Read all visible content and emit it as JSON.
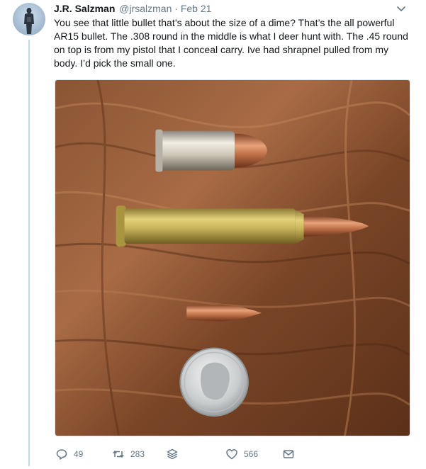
{
  "tweet": {
    "author_name": "J.R. Salzman",
    "handle": "@jrsalzman",
    "separator": "·",
    "date": "Feb 21",
    "text": "You see that little bullet that’s about the size of a dime? That’s the all powerful AR15 bullet. The .308 round in the middle is what I deer hunt with. The .45 round on top is from my pistol that I conceal carry. Ive had shrapnel pulled from my body. I’d pick the small one."
  },
  "actions": {
    "reply_count": "49",
    "retweet_count": "283",
    "like_count": "566"
  },
  "icons": {
    "avatar": "profile-photo",
    "more": "chevron-down-icon",
    "reply": "reply-icon",
    "retweet": "retweet-icon",
    "stack": "layers-icon",
    "like": "heart-icon",
    "dm": "envelope-icon"
  },
  "colors": {
    "muted": "#657786",
    "thread_line": "#c4d9e6",
    "text": "#14171a"
  }
}
